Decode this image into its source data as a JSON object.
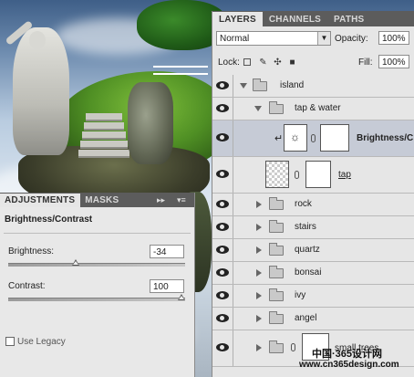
{
  "layers_panel": {
    "tabs": [
      "LAYERS",
      "CHANNELS",
      "PATHS"
    ],
    "blend_mode": "Normal",
    "opacity_label": "Opacity:",
    "opacity_value": "100%",
    "lock_label": "Lock:",
    "fill_label": "Fill:",
    "fill_value": "100%",
    "layers": [
      {
        "name": "island",
        "type": "group",
        "expanded": true
      },
      {
        "name": "tap & water",
        "type": "group",
        "expanded": true
      },
      {
        "name": "Brightness/C",
        "type": "adjustment",
        "selected": true
      },
      {
        "name": "tap",
        "type": "layer"
      },
      {
        "name": "rock",
        "type": "group"
      },
      {
        "name": "stairs",
        "type": "group"
      },
      {
        "name": "quartz",
        "type": "group"
      },
      {
        "name": "bonsai",
        "type": "group"
      },
      {
        "name": "ivy",
        "type": "group"
      },
      {
        "name": "angel",
        "type": "group"
      },
      {
        "name": "small trees",
        "type": "group"
      }
    ]
  },
  "adjustments_panel": {
    "tabs": [
      "ADJUSTMENTS",
      "MASKS"
    ],
    "title": "Brightness/Contrast",
    "brightness_label": "Brightness:",
    "brightness_value": "-34",
    "brightness_fraction": 0.38,
    "contrast_label": "Contrast:",
    "contrast_value": "100",
    "contrast_fraction": 1.0,
    "use_legacy_label": "Use Legacy",
    "use_legacy_checked": false
  },
  "watermark": {
    "line1": "中国·365设计网",
    "line2": "www.cn365design.com"
  }
}
